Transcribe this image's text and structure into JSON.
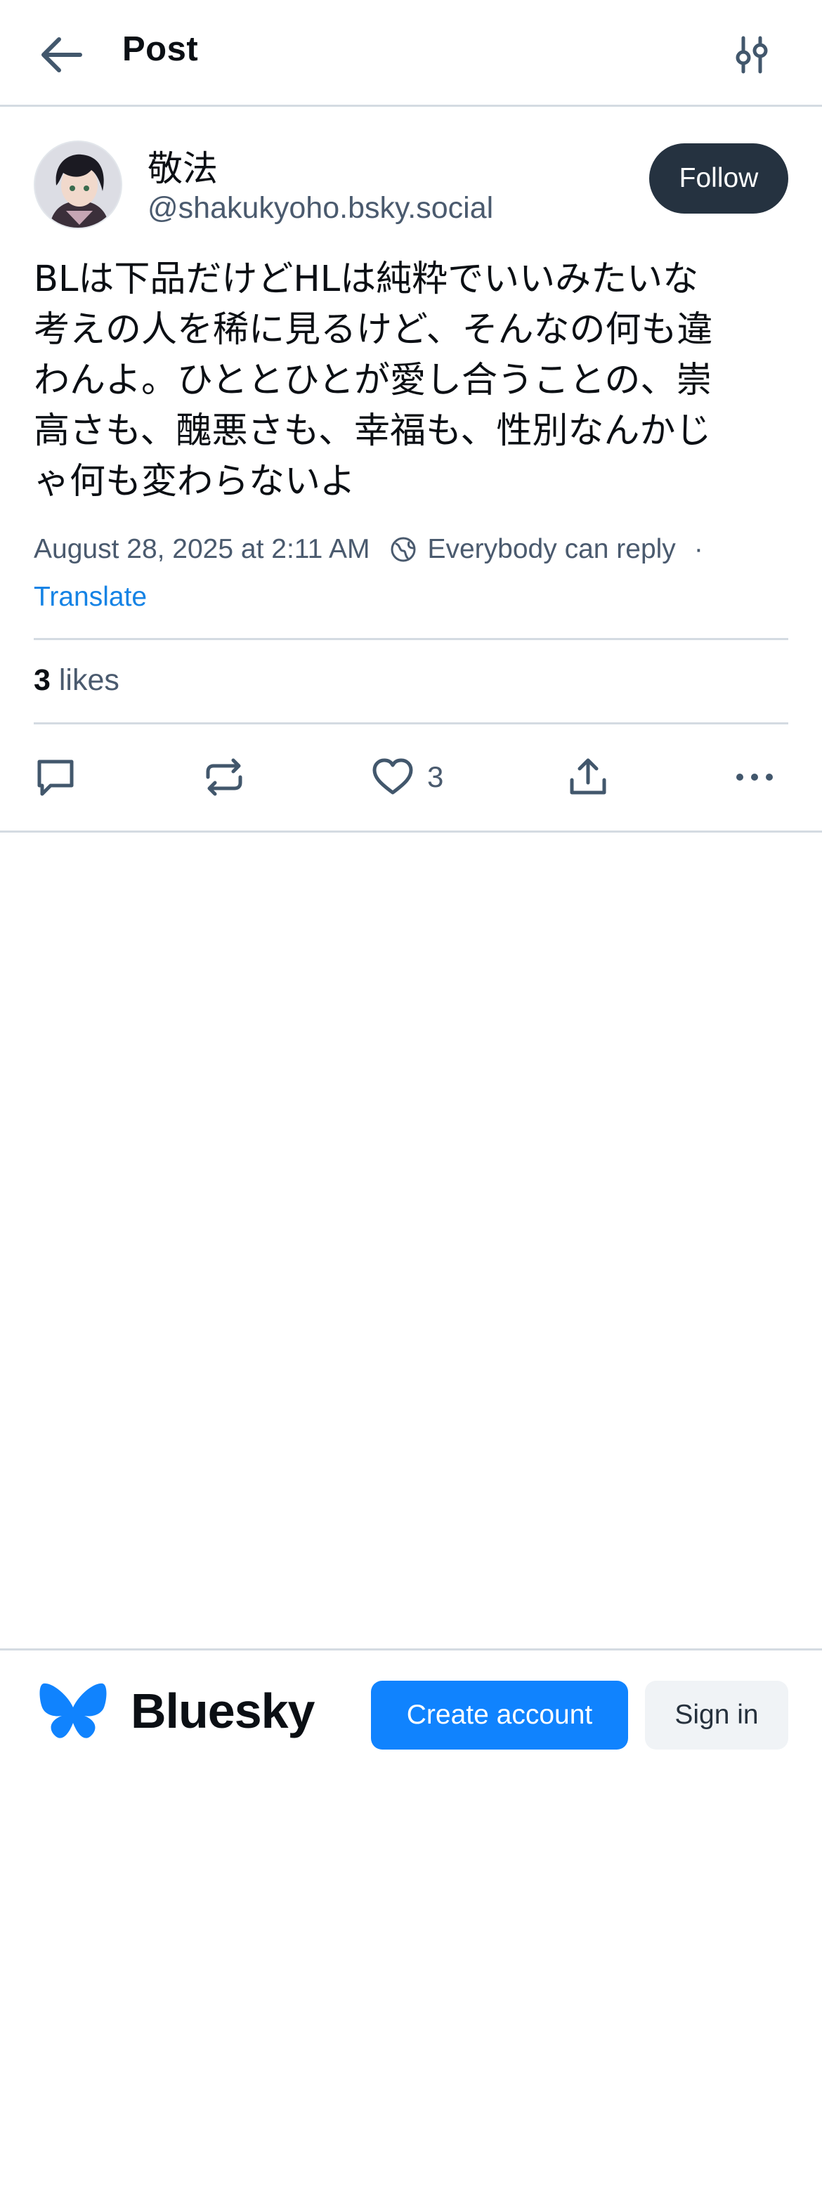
{
  "header": {
    "title": "Post",
    "back_icon": "arrow-left-icon",
    "settings_icon": "sliders-icon"
  },
  "author": {
    "display_name": "敬法",
    "handle": "@shakukyoho.bsky.social",
    "follow_label": "Follow"
  },
  "post": {
    "text": "BLは下品だけどHLは純粋でいいみたいな\n考えの人を稀に見るけど、そんなの何も違\nわんよ。ひととひとが愛し合うことの、崇\n高さも、醜悪さも、幸福も、性別なんかじ\nゃ何も変わらないよ",
    "timestamp": "August 28, 2025 at 2:11 AM",
    "reply_setting": "Everybody can reply",
    "separator": "·",
    "translate_label": "Translate"
  },
  "stats": {
    "likes_count": "3",
    "likes_label": "likes"
  },
  "actions": {
    "reply_icon": "comment-icon",
    "repost_icon": "repost-icon",
    "like_icon": "heart-icon",
    "like_count": "3",
    "share_icon": "share-icon",
    "more_icon": "more-icon"
  },
  "footer": {
    "brand": "Bluesky",
    "create_account_label": "Create account",
    "sign_in_label": "Sign in"
  },
  "colors": {
    "accent": "#1083fe",
    "link": "#1583e5",
    "follow_bg": "#253240",
    "muted_text": "#4a5a6e"
  }
}
